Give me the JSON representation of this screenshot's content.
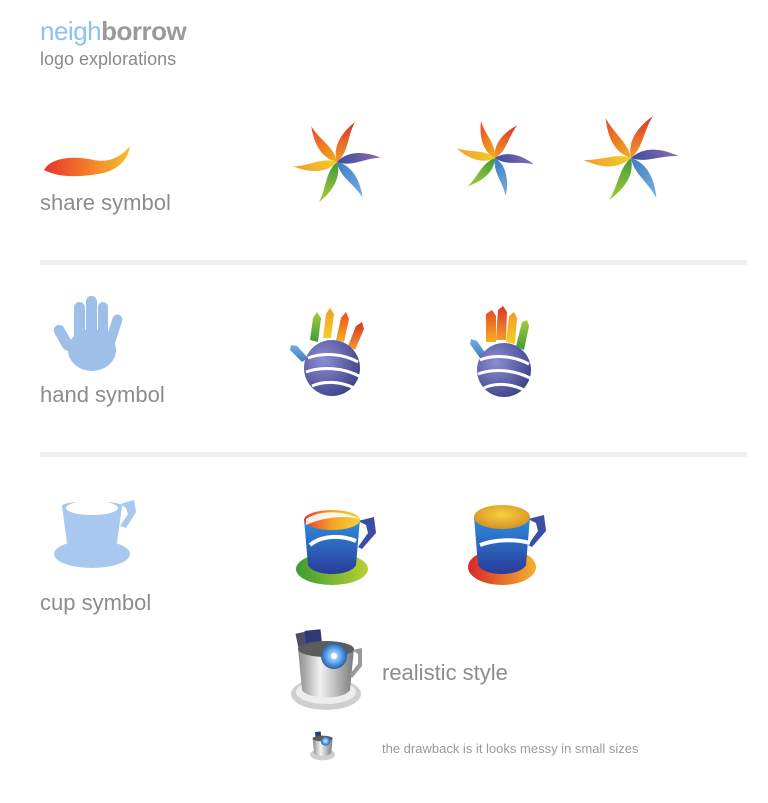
{
  "header": {
    "title_part1": "neigh",
    "title_part2": "borrow",
    "subtitle": "logo explorations"
  },
  "sections": {
    "share": {
      "label": "share symbol",
      "accent": "#f2a020"
    },
    "hand": {
      "label": "hand symbol",
      "accent": "#9dbfe8"
    },
    "cup": {
      "label": "cup symbol",
      "accent": "#a9c8ef"
    }
  },
  "realistic": {
    "label": "realistic style",
    "note": "the drawback is it looks messy in small sizes"
  },
  "palette": {
    "light_blue": "#9dbfe8",
    "text_gray": "#8c8c8c",
    "divider": "#efefef"
  },
  "icons": [
    "flame-icon",
    "pinwheel-icon",
    "hand-icon",
    "hand-globe-icon",
    "cup-icon",
    "colorful-cup-icon",
    "realistic-cup-icon"
  ]
}
